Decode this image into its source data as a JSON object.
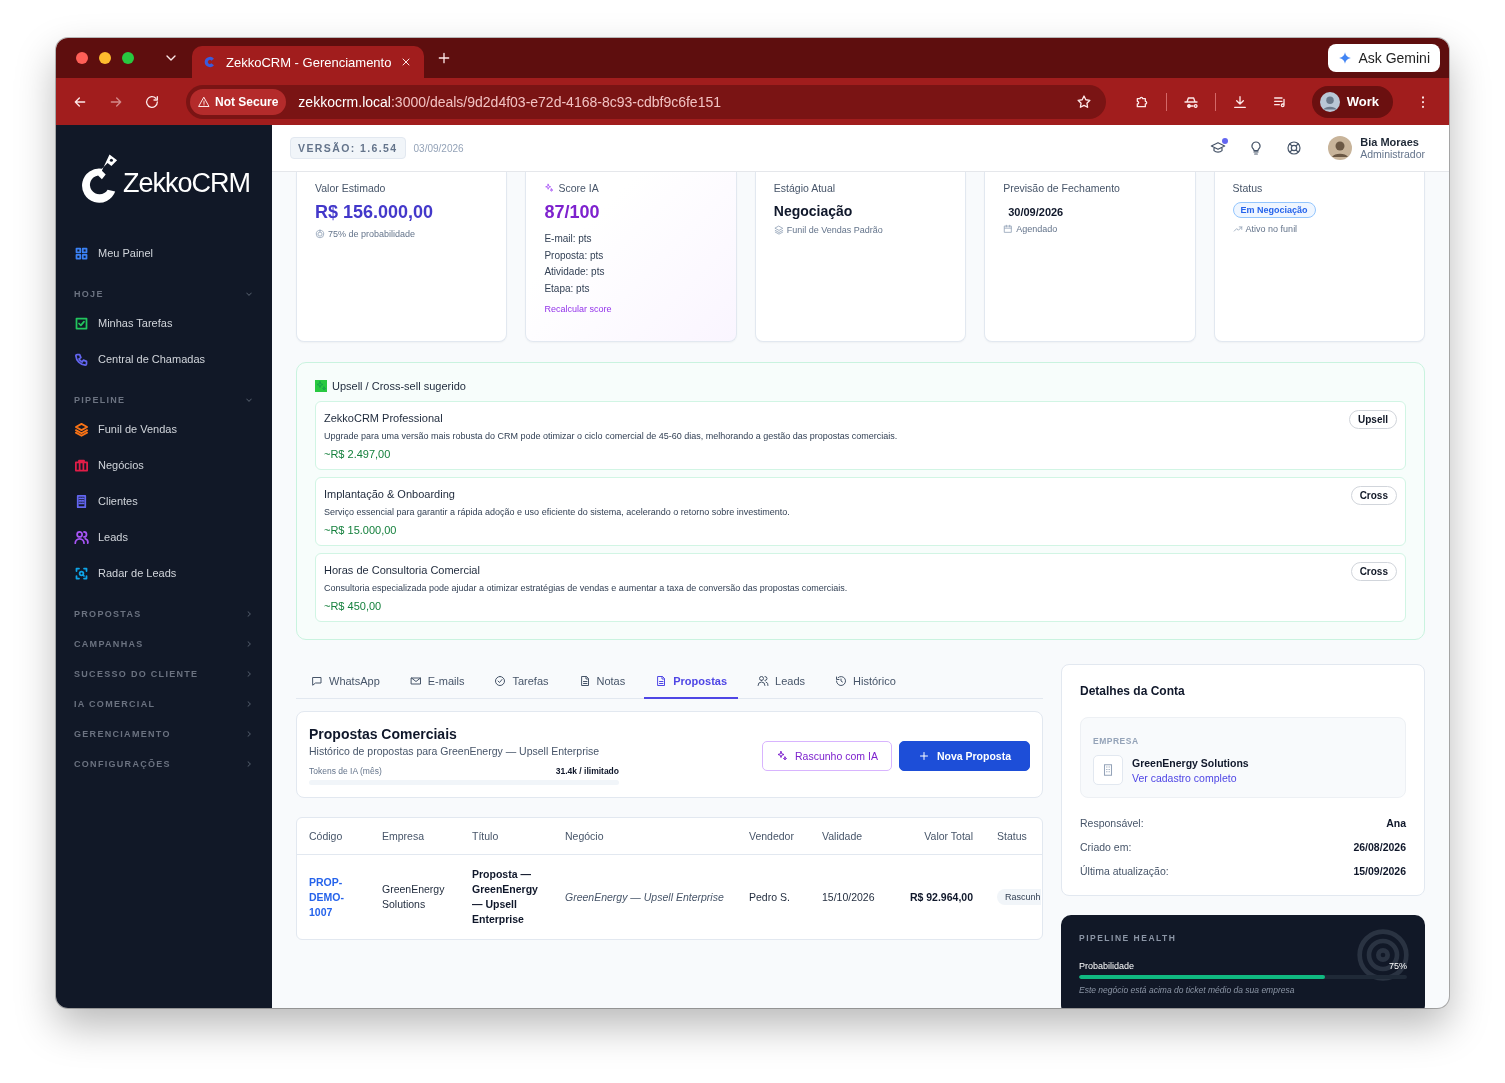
{
  "browser": {
    "tabs": [
      {
        "title": "ZekkoCRM - Gerenciamento",
        "selected": true
      }
    ],
    "assistant_button": "Ask Gemini",
    "security": "Not Secure",
    "url_host": "zekkocrm.local",
    "url_path": ":3000/deals/9d2d4f03-e72d-4168-8c93-cdbf9c6fe151",
    "profile": "Work"
  },
  "sidebar": {
    "logo": "ZekkoCRM",
    "nav": [
      {
        "kind": "link",
        "label": "Meu Painel",
        "color": "#3b82f6"
      },
      {
        "kind": "section",
        "label": "HOJE",
        "expanded": true,
        "children": [
          {
            "label": "Minhas Tarefas",
            "color": "#22c55e"
          },
          {
            "label": "Central de Chamadas",
            "color": "#6366f1"
          }
        ]
      },
      {
        "kind": "section",
        "label": "PIPELINE",
        "expanded": true,
        "children": [
          {
            "label": "Funil de Vendas",
            "color": "#f97316"
          },
          {
            "label": "Negócios",
            "color": "#e11d48"
          },
          {
            "label": "Clientes",
            "color": "#6366f1"
          },
          {
            "label": "Leads",
            "color": "#a855f7"
          },
          {
            "label": "Radar de Leads",
            "color": "#0ea5e9"
          }
        ]
      },
      {
        "kind": "section",
        "label": "PROPOSTAS",
        "expanded": false
      },
      {
        "kind": "section",
        "label": "CAMPANHAS",
        "expanded": false
      },
      {
        "kind": "section",
        "label": "SUCESSO DO CLIENTE",
        "expanded": false
      },
      {
        "kind": "section",
        "label": "IA COMERCIAL",
        "expanded": false
      },
      {
        "kind": "section",
        "label": "GERENCIAMENTO",
        "expanded": false
      },
      {
        "kind": "section",
        "label": "CONFIGURAÇÕES",
        "expanded": false
      }
    ]
  },
  "header": {
    "version": "VERSÃO: 1.6.54",
    "date": "03/09/2026",
    "notification": true,
    "user": {
      "name": "Bia Moraes",
      "role": "Administrador"
    }
  },
  "stats": [
    {
      "kind": "value",
      "label": "Valor Estimado",
      "value": "R$ 156.000,00",
      "note": "75% de probabilidade"
    },
    {
      "kind": "score",
      "label": "Score IA",
      "value": "87/100",
      "breakdown": [
        "E-mail: pts",
        "Proposta: pts",
        "Atividade: pts",
        "Etapa: pts"
      ],
      "action": "Recalcular score"
    },
    {
      "kind": "stage",
      "label": "Estágio Atual",
      "value": "Negociação",
      "note": "Funil de Vendas Padrão"
    },
    {
      "kind": "date",
      "label": "Previsão de Fechamento",
      "value": "30/09/2026",
      "note": "Agendado"
    },
    {
      "kind": "status",
      "label": "Status",
      "value": "Em Negociação",
      "note": "Ativo no funil"
    }
  ],
  "upsell": {
    "title": "Upsell / Cross-sell sugerido",
    "suggestions": [
      {
        "name": "ZekkoCRM Professional",
        "description": "Upgrade para uma versão mais robusta do CRM pode otimizar o ciclo comercial de 45-60 dias, melhorando a gestão das propostas comerciais.",
        "price": "~R$ 2.497,00",
        "tag": "Upsell"
      },
      {
        "name": "Implantação & Onboarding",
        "description": "Serviço essencial para garantir a rápida adoção e uso eficiente do sistema, acelerando o retorno sobre investimento.",
        "price": "~R$ 15.000,00",
        "tag": "Cross"
      },
      {
        "name": "Horas de Consultoria Comercial",
        "description": "Consultoria especializada pode ajudar a otimizar estratégias de vendas e aumentar a taxa de conversão das propostas comerciais.",
        "price": "~R$ 450,00",
        "tag": "Cross"
      }
    ]
  },
  "tabs": [
    {
      "label": "WhatsApp",
      "selected": false
    },
    {
      "label": "E-mails",
      "selected": false
    },
    {
      "label": "Tarefas",
      "selected": false
    },
    {
      "label": "Notas",
      "selected": false
    },
    {
      "label": "Propostas",
      "selected": true
    },
    {
      "label": "Leads",
      "selected": false
    },
    {
      "label": "Histórico",
      "selected": false
    }
  ],
  "proposals": {
    "title": "Propostas Comerciais",
    "subtitle": "Histórico de propostas para GreenEnergy — Upsell Enterprise",
    "tokens_label": "Tokens de IA (mês)",
    "tokens_value": "31.4k / ilimitado",
    "buttons": [
      {
        "kind": "ai",
        "label": "Rascunho com IA"
      },
      {
        "kind": "primary",
        "label": "Nova Proposta"
      }
    ],
    "columns": [
      "Código",
      "Empresa",
      "Título",
      "Negócio",
      "Vendedor",
      "Validade",
      "Valor Total",
      "Status"
    ],
    "rows": [
      {
        "code": "PROP-DEMO-1007",
        "company": "GreenEnergy Solutions",
        "title": "Proposta — GreenEnergy — Upsell Enterprise",
        "deal": "GreenEnergy — Upsell Enterprise",
        "seller": "Pedro S.",
        "validity": "15/10/2026",
        "total": "R$ 92.964,00",
        "status": "Rascunh"
      }
    ]
  },
  "account": {
    "title": "Detalhes da Conta",
    "company_label": "EMPRESA",
    "company": "GreenEnergy Solutions",
    "company_link": "Ver cadastro completo",
    "fields": [
      {
        "label": "Responsável:",
        "value": "Ana"
      },
      {
        "label": "Criado em:",
        "value": "26/08/2026"
      },
      {
        "label": "Última atualização:",
        "value": "15/09/2026"
      }
    ]
  },
  "pipeline": {
    "title": "PIPELINE HEALTH",
    "metric": "Probabilidade",
    "value": "75%",
    "level": 0.75,
    "note": "Este negócio está acima do ticket médio da sua empresa"
  }
}
